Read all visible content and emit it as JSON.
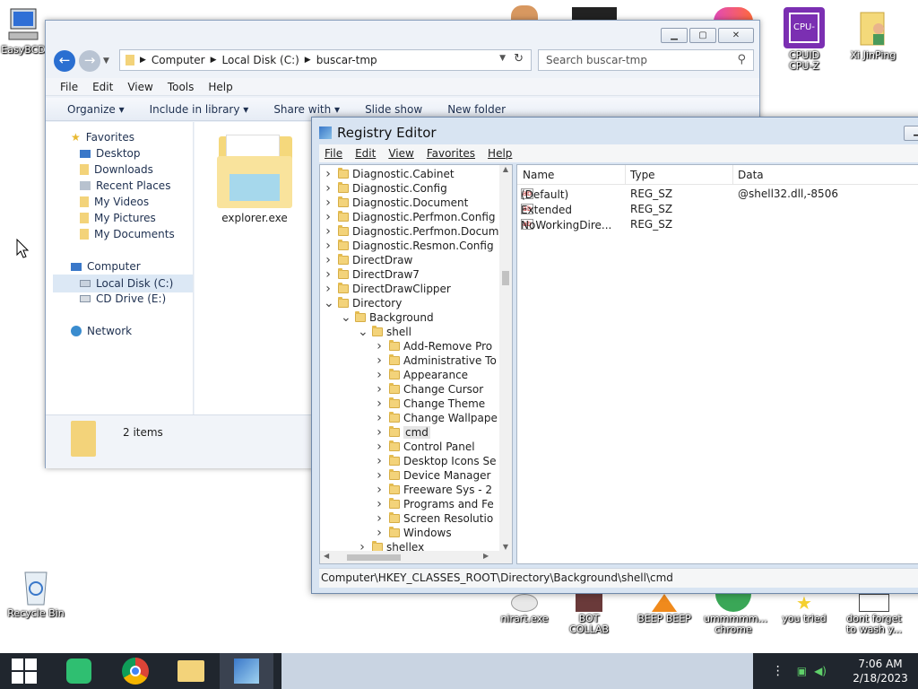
{
  "desktop": {
    "icons_left": [
      {
        "label": "EasyBCD"
      },
      {
        "label": "Recycle Bin"
      }
    ],
    "icons_top_right": [
      {
        "label": "CPUID CPU-Z"
      },
      {
        "label": "Xi JinPing"
      }
    ],
    "icons_bottom": [
      {
        "label": "nirart.exe"
      },
      {
        "label": "BOT COLLAB"
      },
      {
        "label": "BEEP BEEP"
      },
      {
        "label": "ummmmm... chrome"
      },
      {
        "label": "you tried"
      },
      {
        "label": "dont forget to wash y..."
      }
    ]
  },
  "explorer": {
    "breadcrumb": [
      "Computer",
      "Local Disk (C:)",
      "buscar-tmp"
    ],
    "search_placeholder": "Search buscar-tmp",
    "menu": [
      "File",
      "Edit",
      "View",
      "Tools",
      "Help"
    ],
    "toolbar": {
      "organize": "Organize",
      "include": "Include in library",
      "share": "Share with",
      "slideshow": "Slide show",
      "newfolder": "New folder"
    },
    "nav": {
      "favorites": "Favorites",
      "fav_items": [
        "Desktop",
        "Downloads",
        "Recent Places",
        "My Videos",
        "My Pictures",
        "My Documents"
      ],
      "computer": "Computer",
      "computer_items": [
        "Local Disk (C:)",
        "CD Drive (E:)"
      ],
      "network": "Network"
    },
    "files": [
      {
        "name": "explorer.exe"
      }
    ],
    "status": "2 items"
  },
  "regedit": {
    "title": "Registry Editor",
    "menu": [
      "File",
      "Edit",
      "View",
      "Favorites",
      "Help"
    ],
    "tree": [
      {
        "label": "Diagnostic.Cabinet",
        "level": 0,
        "expanded": false,
        "selected": false
      },
      {
        "label": "Diagnostic.Config",
        "level": 0,
        "expanded": false,
        "selected": false
      },
      {
        "label": "Diagnostic.Document",
        "level": 0,
        "expanded": false,
        "selected": false
      },
      {
        "label": "Diagnostic.Perfmon.Config",
        "level": 0,
        "expanded": false,
        "selected": false
      },
      {
        "label": "Diagnostic.Perfmon.Docume",
        "level": 0,
        "expanded": false,
        "selected": false
      },
      {
        "label": "Diagnostic.Resmon.Config",
        "level": 0,
        "expanded": false,
        "selected": false
      },
      {
        "label": "DirectDraw",
        "level": 0,
        "expanded": false,
        "selected": false
      },
      {
        "label": "DirectDraw7",
        "level": 0,
        "expanded": false,
        "selected": false
      },
      {
        "label": "DirectDrawClipper",
        "level": 0,
        "expanded": false,
        "selected": false
      },
      {
        "label": "Directory",
        "level": 0,
        "expanded": true,
        "selected": false
      },
      {
        "label": "Background",
        "level": 1,
        "expanded": true,
        "selected": false
      },
      {
        "label": "shell",
        "level": 2,
        "expanded": true,
        "selected": false
      },
      {
        "label": "Add-Remove Pro",
        "level": 3,
        "expanded": false,
        "selected": false
      },
      {
        "label": "Administrative To",
        "level": 3,
        "expanded": false,
        "selected": false
      },
      {
        "label": "Appearance",
        "level": 3,
        "expanded": false,
        "selected": false
      },
      {
        "label": "Change Cursor",
        "level": 3,
        "expanded": false,
        "selected": false
      },
      {
        "label": "Change Theme",
        "level": 3,
        "expanded": false,
        "selected": false
      },
      {
        "label": "Change Wallpape",
        "level": 3,
        "expanded": false,
        "selected": false
      },
      {
        "label": "cmd",
        "level": 3,
        "expanded": false,
        "selected": true
      },
      {
        "label": "Control Panel",
        "level": 3,
        "expanded": false,
        "selected": false
      },
      {
        "label": "Desktop Icons Se",
        "level": 3,
        "expanded": false,
        "selected": false
      },
      {
        "label": "Device Manager",
        "level": 3,
        "expanded": false,
        "selected": false
      },
      {
        "label": "Freeware Sys - 2",
        "level": 3,
        "expanded": false,
        "selected": false
      },
      {
        "label": "Programs and Fe",
        "level": 3,
        "expanded": false,
        "selected": false
      },
      {
        "label": "Screen Resolutio",
        "level": 3,
        "expanded": false,
        "selected": false
      },
      {
        "label": "Windows",
        "level": 3,
        "expanded": false,
        "selected": false
      },
      {
        "label": "shellex",
        "level": 2,
        "expanded": false,
        "selected": false
      }
    ],
    "columns": [
      "Name",
      "Type",
      "Data"
    ],
    "values": [
      {
        "name": "(Default)",
        "type": "REG_SZ",
        "data": "@shell32.dll,-8506"
      },
      {
        "name": "Extended",
        "type": "REG_SZ",
        "data": ""
      },
      {
        "name": "NoWorkingDire...",
        "type": "REG_SZ",
        "data": ""
      }
    ],
    "status_path": "Computer\\HKEY_CLASSES_ROOT\\Directory\\Background\\shell\\cmd"
  },
  "taskbar": {
    "time": "7:06 AM",
    "date": "2/18/2023"
  },
  "colors": {
    "taskbar": "#20262e",
    "selection": "#cce8ff",
    "explorer_frame": "#eef2f8",
    "regedit_frame": "#d8e4f2"
  }
}
